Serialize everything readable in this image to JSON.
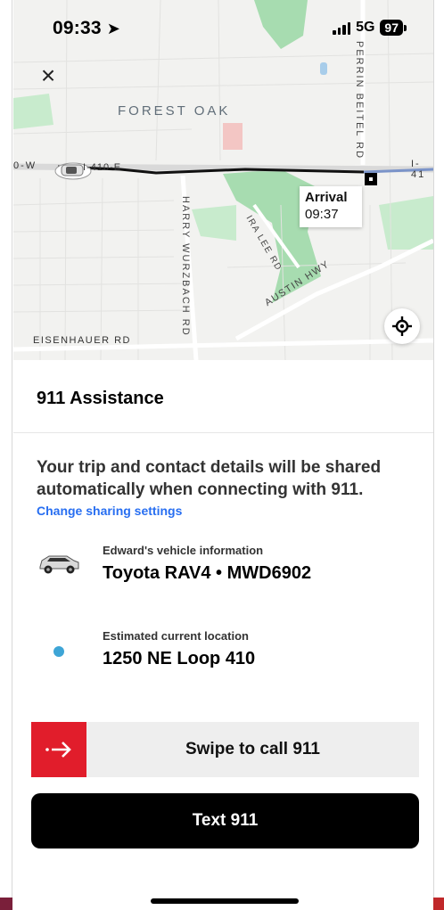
{
  "status_bar": {
    "time": "09:33",
    "network": "5G",
    "battery": "97"
  },
  "map": {
    "labels": {
      "forest_oak": "FOREST OAK",
      "perrin_beitel": "PERRIN BEITEL RD",
      "harry_wurzbach": "HARRY WURZBACH RD",
      "ira_lee": "IRA LEE RD",
      "austin_hwy": "AUSTIN HWY",
      "eisenhauer": "EISENHAUER RD",
      "i410_west": "I-410-E",
      "i410_east": "I-41",
      "w_cutoff": "0-W"
    },
    "arrival": {
      "label": "Arrival",
      "time": "09:37"
    },
    "colors": {
      "route": "#111111",
      "route_ahead": "#7b94c9",
      "park": "#9fd8a8",
      "water": "#a8cdea",
      "pink": "#f3c6c4"
    }
  },
  "sheet": {
    "title": "911 Assistance",
    "info": "Your trip and contact details will be shared automatically when connecting with 911.",
    "change_link": "Change sharing settings",
    "vehicle": {
      "label": "Edward's vehicle information",
      "value": "Toyota RAV4 • MWD6902",
      "icon": "car-icon"
    },
    "location": {
      "label": "Estimated current location",
      "value": "1250 NE Loop 410",
      "icon": "location-dot"
    }
  },
  "actions": {
    "swipe_label": "Swipe to call 911",
    "swipe_icon": "arrow-right-icon",
    "swipe_color": "#e11d2b",
    "text_label": "Text 911"
  }
}
